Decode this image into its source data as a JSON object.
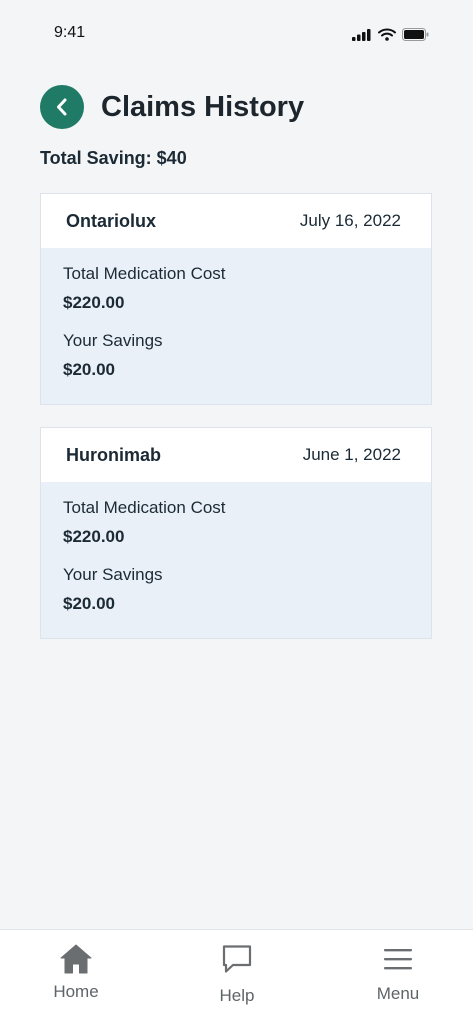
{
  "status_bar": {
    "time": "9:41"
  },
  "header": {
    "title": "Claims History",
    "back_icon": "chevron-left-icon"
  },
  "summary": {
    "total_saving": "Total Saving: $40"
  },
  "claims": [
    {
      "name": "Ontariolux",
      "date": "July 16, 2022",
      "cost_label": "Total Medication Cost",
      "cost_value": "$220.00",
      "savings_label": "Your Savings",
      "savings_value": "$20.00"
    },
    {
      "name": "Huronimab",
      "date": "June 1, 2022",
      "cost_label": "Total Medication Cost",
      "cost_value": "$220.00",
      "savings_label": "Your Savings",
      "savings_value": "$20.00"
    }
  ],
  "bottom_nav": {
    "items": [
      {
        "label": "Home",
        "icon": "home-icon"
      },
      {
        "label": "Help",
        "icon": "chat-bubble-icon"
      },
      {
        "label": "Menu",
        "icon": "hamburger-menu-icon"
      }
    ]
  },
  "colors": {
    "accent": "#1f7a66",
    "background": "#f3f5f7",
    "card_body": "#eaf0f7",
    "text": "#1b2a35",
    "nav_icon": "#6b6e71"
  }
}
